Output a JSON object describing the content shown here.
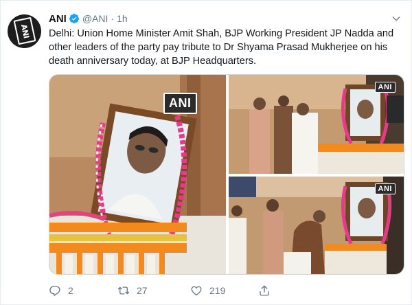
{
  "tweet": {
    "display_name": "ANI",
    "handle": "@ANI",
    "separator": "·",
    "time": "1h",
    "avatar_logo": "ANI",
    "text": "Delhi: Union Home Minister Amit Shah, BJP Working President JP Nadda and other leaders of the party pay tribute to Dr Shyama Prasad Mukherjee on his death anniversary today, at BJP Headquarters."
  },
  "media": {
    "watermarks": [
      "ANI",
      "ANI",
      "ANI"
    ]
  },
  "actions": {
    "replies": "2",
    "retweets": "27",
    "likes": "219"
  },
  "icons": {
    "verified": "verified-badge-icon",
    "caret": "chevron-down-icon",
    "reply": "reply-icon",
    "retweet": "retweet-icon",
    "like": "heart-icon",
    "share": "share-icon"
  },
  "colors": {
    "accent": "#1da1f2",
    "muted_text": "#657786",
    "text": "#14171a",
    "border": "#e6ecf0"
  }
}
